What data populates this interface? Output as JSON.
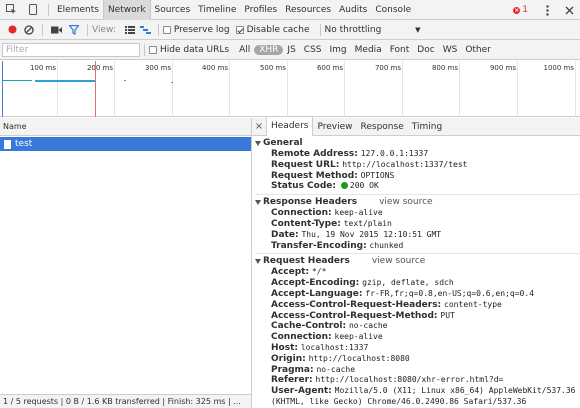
{
  "panel_tabs": [
    "Elements",
    "Network",
    "Sources",
    "Timeline",
    "Profiles",
    "Resources",
    "Audits",
    "Console"
  ],
  "error_count": "1",
  "toolbar": {
    "view_label": "View:",
    "preserve_log_label": "Preserve log",
    "disable_cache_label": "Disable cache",
    "throttling_value": "No throttling",
    "preserve_log_checked": false,
    "disable_cache_checked": true
  },
  "filter": {
    "placeholder": "Filter",
    "hide_data_urls_label": "Hide data URLs",
    "types": [
      "All",
      "XHR",
      "JS",
      "CSS",
      "Img",
      "Media",
      "Font",
      "Doc",
      "WS",
      "Other"
    ],
    "active_type": "XHR"
  },
  "timeline_ticks": [
    "100 ms",
    "200 ms",
    "300 ms",
    "400 ms",
    "500 ms",
    "600 ms",
    "700 ms",
    "800 ms",
    "900 ms",
    "1000 ms"
  ],
  "request_list": {
    "header_name": "Name",
    "requests": [
      {
        "name": "test"
      }
    ]
  },
  "status_bar": "1 / 5 requests  |  0 B / 1.6 KB transferred  |  Finish: 325 ms  |  ...",
  "detail_tabs": [
    "Headers",
    "Preview",
    "Response",
    "Timing"
  ],
  "headers": {
    "general_title": "General",
    "general": [
      {
        "k": "Remote Address:",
        "v": "127.0.0.1:1337"
      },
      {
        "k": "Request URL:",
        "v": "http://localhost:1337/test"
      },
      {
        "k": "Request Method:",
        "v": "OPTIONS"
      },
      {
        "k": "Status Code:",
        "v": "200 OK"
      }
    ],
    "response_title": "Response Headers",
    "view_source": "view source",
    "response": [
      {
        "k": "Connection:",
        "v": "keep-alive"
      },
      {
        "k": "Content-Type:",
        "v": "text/plain"
      },
      {
        "k": "Date:",
        "v": "Thu, 19 Nov 2015 12:10:51 GMT"
      },
      {
        "k": "Transfer-Encoding:",
        "v": "chunked"
      }
    ],
    "request_title": "Request Headers",
    "request": [
      {
        "k": "Accept:",
        "v": "*/*"
      },
      {
        "k": "Accept-Encoding:",
        "v": "gzip, deflate, sdch"
      },
      {
        "k": "Accept-Language:",
        "v": "fr-FR,fr;q=0.8,en-US;q=0.6,en;q=0.4"
      },
      {
        "k": "Access-Control-Request-Headers:",
        "v": "content-type"
      },
      {
        "k": "Access-Control-Request-Method:",
        "v": "PUT"
      },
      {
        "k": "Cache-Control:",
        "v": "no-cache"
      },
      {
        "k": "Connection:",
        "v": "keep-alive"
      },
      {
        "k": "Host:",
        "v": "localhost:1337"
      },
      {
        "k": "Origin:",
        "v": "http://localhost:8080"
      },
      {
        "k": "Pragma:",
        "v": "no-cache"
      },
      {
        "k": "Referer:",
        "v": "http://localhost:8080/xhr-error.html?d="
      },
      {
        "k": "User-Agent:",
        "v": "Mozilla/5.0 (X11; Linux x86_64) AppleWebKit/537.36 (KHTML, like Gecko) Chrome/46.0.2490.86 Safari/537.36"
      }
    ]
  },
  "colors": {
    "accent": "#3879d9",
    "record": "#e62828",
    "status_ok": "#1a9b1a"
  }
}
